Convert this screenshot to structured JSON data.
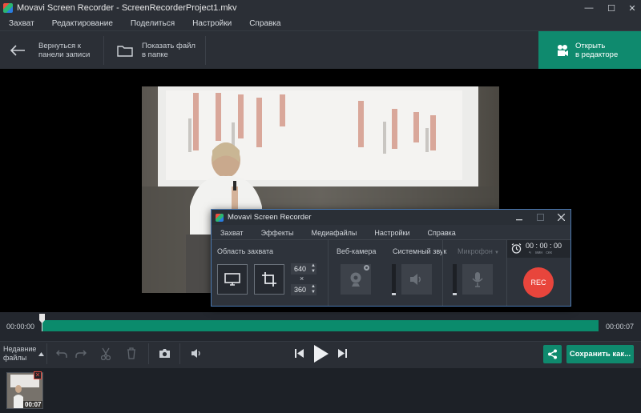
{
  "window": {
    "title": "Movavi Screen Recorder - ScreenRecorderProject1.mkv",
    "controls": {
      "minimize": "—",
      "maximize": "☐",
      "close": "✕"
    }
  },
  "menu": [
    "Захват",
    "Редактирование",
    "Поделиться",
    "Настройки",
    "Справка"
  ],
  "toolbar": {
    "back_line1": "Вернуться к",
    "back_line2": "панели записи",
    "show_line1": "Показать файл",
    "show_line2": "в папке",
    "open_line1": "Открыть",
    "open_line2": "в редакторе"
  },
  "timeline": {
    "start": "00:00:00",
    "end": "00:00:07",
    "progress": 0.0
  },
  "controls": {
    "recent_line1": "Недавние",
    "recent_line2": "файлы",
    "save_label": "Сохранить как..."
  },
  "thumb": {
    "duration": "00:07"
  },
  "recorder": {
    "title": "Movavi Screen Recorder",
    "menu": [
      "Захват",
      "Эффекты",
      "Медиафайлы",
      "Настройки",
      "Справка"
    ],
    "capture_area_label": "Область захвата",
    "width": "640",
    "height": "360",
    "times_sign": "×",
    "webcam_label": "Веб-камера",
    "system_sound_label": "Системный звук",
    "mic_label": "Микрофон",
    "timer": "00 : 00 : 00",
    "timer_units": "ч    мин   сек",
    "rec_label": "REC"
  },
  "colors": {
    "accent": "#0f8a6e",
    "rec": "#e8453c",
    "background": "#1e2229"
  }
}
